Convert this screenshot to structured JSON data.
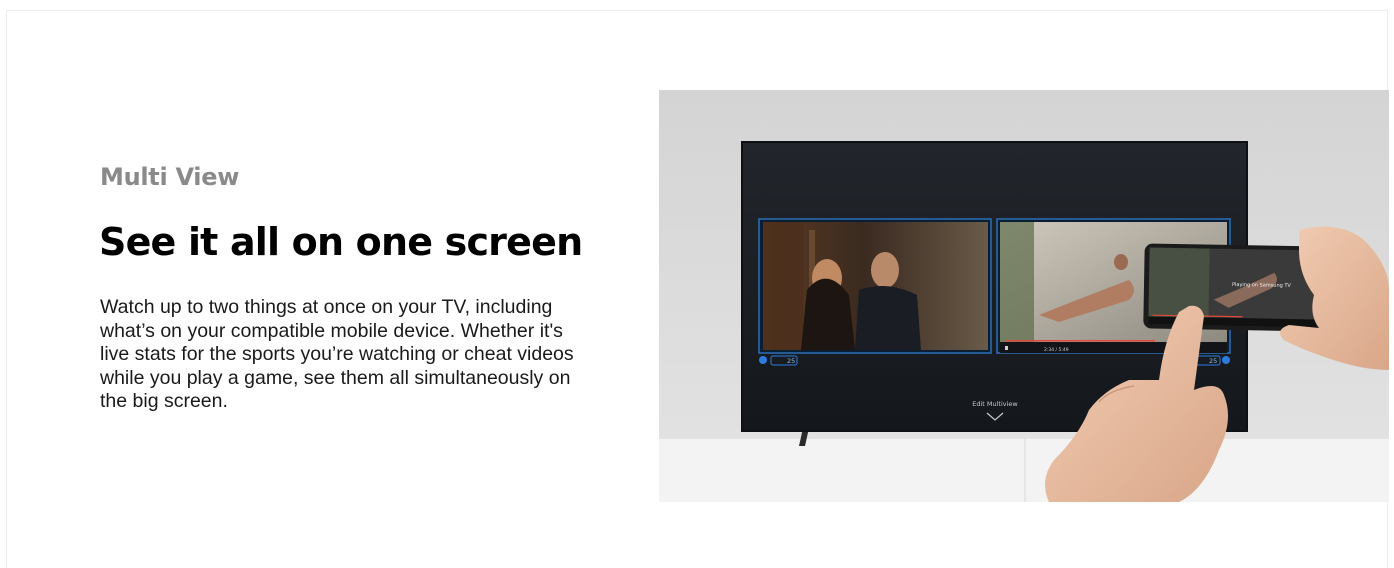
{
  "section": {
    "eyebrow": "Multi View",
    "headline": "See it all on one screen",
    "body": "Watch up to two things at once on your TV, including what’s on your compatible mobile device. Whether it's live stats for the sports you’re watching or cheat videos while you play a game, see them all simultaneously on the big screen."
  },
  "hero_image": {
    "tv_menu_label": "Edit Multiview",
    "phone_screen_text": "Playing on Samsung TV",
    "left_tile_badge": "25",
    "right_tile_badge": "25",
    "player_time": "2:34 / 5:49",
    "colors": {
      "wall": "#d9d9d9",
      "tv_bezel": "#111317",
      "tv_screen": "#1a1d22",
      "tile_border": "#2a6fb5",
      "cabinet": "#f2f2f2",
      "badge_blue": "#2d7be0"
    }
  }
}
